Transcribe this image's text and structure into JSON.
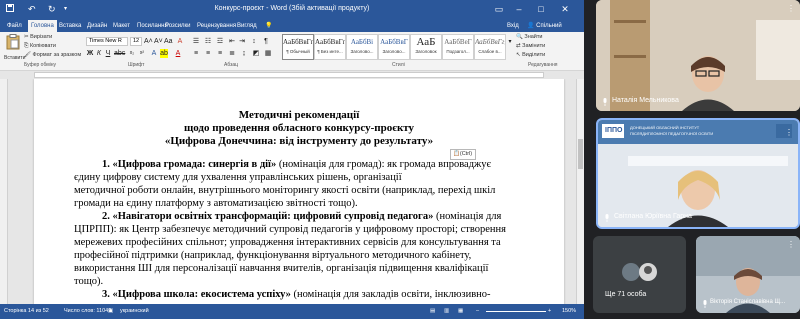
{
  "word": {
    "doc_title": "Конкурс-проєкт - Word (Збій активації продукту)",
    "tabs": [
      "Файл",
      "Головна",
      "Вставка",
      "Дизайн",
      "Макет",
      "Посилання",
      "Розсилки",
      "Рецензування",
      "Вигляд"
    ],
    "active_tab": 1,
    "right_tabs": {
      "login": "Вхід",
      "share": "Спільний доступ"
    },
    "clipboard": {
      "paste": "Вставити",
      "cut": "Вирізати",
      "copy": "Копіювати",
      "format_painter": "Формат за зразком",
      "label": "Буфер обміну"
    },
    "font": {
      "name": "Times New R",
      "size": "12",
      "label": "Шрифт"
    },
    "paragraph_label": "Абзац",
    "styles": [
      {
        "sample": "АаБбВвГг,",
        "name": "¶ Обычный"
      },
      {
        "sample": "АаБбВвГг,",
        "name": "¶ Без инте..."
      },
      {
        "sample": "АаБбВі",
        "name": "Заголово..."
      },
      {
        "sample": "АаБбВвГ",
        "name": "Заголово..."
      },
      {
        "sample": "АаБ",
        "name": "Заголовок"
      },
      {
        "sample": "АаБбВеГ",
        "name": "Подзагол..."
      },
      {
        "sample": "АаБбВвГг,",
        "name": "Слабое в..."
      }
    ],
    "styles_label": "Стилі",
    "editing": {
      "find": "Знайти",
      "replace": "Замінити",
      "select": "Виділити",
      "label": "Редагування"
    },
    "document": {
      "heading1": "Методичні рекомендації",
      "heading2": "щодо проведення  обласного конкурсу-проєкту",
      "heading3": "«Цифрова Донеччина: від інструменту до результату»",
      "paste_badge": "(Ctrl)",
      "lines": [
        {
          "bold": "1. «Цифрова громада: синергія в дії»",
          "text": " (номінація для громад): як громада впроваджує"
        },
        {
          "bold": "",
          "text": "єдину цифрову систему для ухвалення управлінських рішень, організації"
        },
        {
          "bold": "",
          "text": "методичної роботи онлайн, внутрішнього моніторингу якості освіти (наприклад, перехід шкіл"
        },
        {
          "bold": "",
          "text": "громади на єдину платформу з автоматизацією звітності тощо)."
        },
        {
          "bold": "2. «Навігатори освітніх трансформацій: цифровий супровід педагога»",
          "text": " (номінація для"
        },
        {
          "bold": "",
          "text": "ЦПРПП): як Центр забезпечує методичний супровід педагогів у цифровому просторі; створення"
        },
        {
          "bold": "",
          "text": "мережевих професійних спільнот; упровадження інтерактивних сервісів для консультування та"
        },
        {
          "bold": "",
          "text": "професійної підтримки (наприклад, функціонування віртуального методичного кабінету,"
        },
        {
          "bold": "",
          "text": "використання ШІ для персоналізації навчання вчителів, організація підвищення кваліфікації"
        },
        {
          "bold": "",
          "text": "тощо)."
        },
        {
          "bold": "3. «Цифрова школа: екосистема успіху»",
          "text": " (номінація для закладів освіти, інклюзивно-"
        }
      ]
    },
    "status": {
      "page": "Сторінка 14 из 52",
      "words": "Число слов: 11049",
      "lang": "украинский",
      "zoom": "150%"
    }
  },
  "meeting": {
    "participants": [
      {
        "name": "Наталія Мельникова"
      },
      {
        "name": "Світлана Юріївна Гарна"
      },
      {
        "name": "Ще 71 особа"
      },
      {
        "name": "Вікторія Станіславівна Щ..."
      }
    ],
    "institute_logo": "ІППО",
    "institute_line1": "ДОНЕЦЬКИЙ ОБЛАСНИЙ ІНСТИТУТ",
    "institute_line2": "ПІСЛЯДИПЛОМНОЇ ПЕДАГОГІЧНОЇ ОСВІТИ"
  }
}
